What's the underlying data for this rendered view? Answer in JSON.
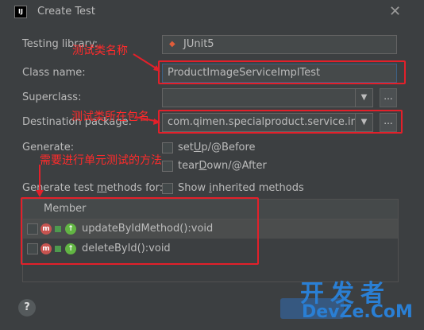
{
  "window": {
    "title": "Create Test"
  },
  "form": {
    "testing_library_label": "Testing library:",
    "testing_library_value": "JUnit5",
    "class_name_label": "Class name:",
    "class_name_value": "ProductImageServiceImplTest",
    "superclass_label": "Superclass:",
    "superclass_value": "",
    "dest_package_label": "Destination package:",
    "dest_package_value": "com.qimen.specialproduct.service.impl",
    "browse": "...",
    "generate_label": "Generate:",
    "setup_pre": "set",
    "setup_u": "U",
    "setup_post": "p/@Before",
    "teardown_pre": "tear",
    "teardown_u": "D",
    "teardown_post": "own/@After",
    "methods_label_pre": "Generate test ",
    "methods_label_u": "m",
    "methods_label_post": "ethods for:",
    "inherited_pre": "Show ",
    "inherited_u": "i",
    "inherited_post": "nherited methods"
  },
  "table": {
    "header": "Member",
    "rows": [
      {
        "name": "updateByIdMethod():void"
      },
      {
        "name": "deleteById():void"
      }
    ]
  },
  "annotations": {
    "class_name": "测试类名称",
    "package": "测试类所在包名",
    "methods": "需要进行单元测试的方法"
  },
  "footer": {
    "help": "?"
  },
  "watermark": {
    "line1": "开发者",
    "line2": "DevZe.CoM"
  },
  "colors": {
    "accent": "#365880",
    "annotation": "#e3202a",
    "watermark": "#2a7fd4"
  }
}
